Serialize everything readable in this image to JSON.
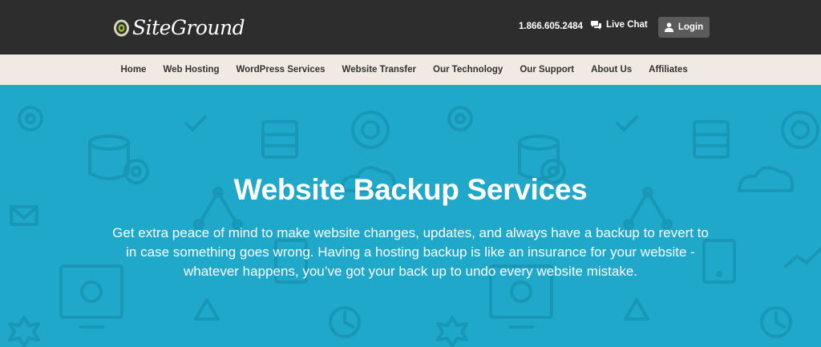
{
  "header": {
    "logo_text": "SiteGround",
    "phone": "1.866.605.2484",
    "live_chat_label": "Live Chat",
    "login_label": "Login"
  },
  "nav": {
    "items": [
      {
        "label": "Home"
      },
      {
        "label": "Web Hosting"
      },
      {
        "label": "WordPress Services"
      },
      {
        "label": "Website Transfer"
      },
      {
        "label": "Our Technology"
      },
      {
        "label": "Our Support"
      },
      {
        "label": "About Us"
      },
      {
        "label": "Affiliates"
      }
    ]
  },
  "hero": {
    "title": "Website Backup Services",
    "description": "Get extra peace of mind to make website changes, updates, and always have a backup to revert to in case something goes wrong. Having a hosting backup is like an insurance for your website - whatever happens, you’ve got your back up to undo every website mistake."
  },
  "colors": {
    "topbar": "#2d2d2d",
    "navbar": "#f0eae2",
    "hero": "#1fa8c9",
    "pattern": "#1897b6"
  }
}
